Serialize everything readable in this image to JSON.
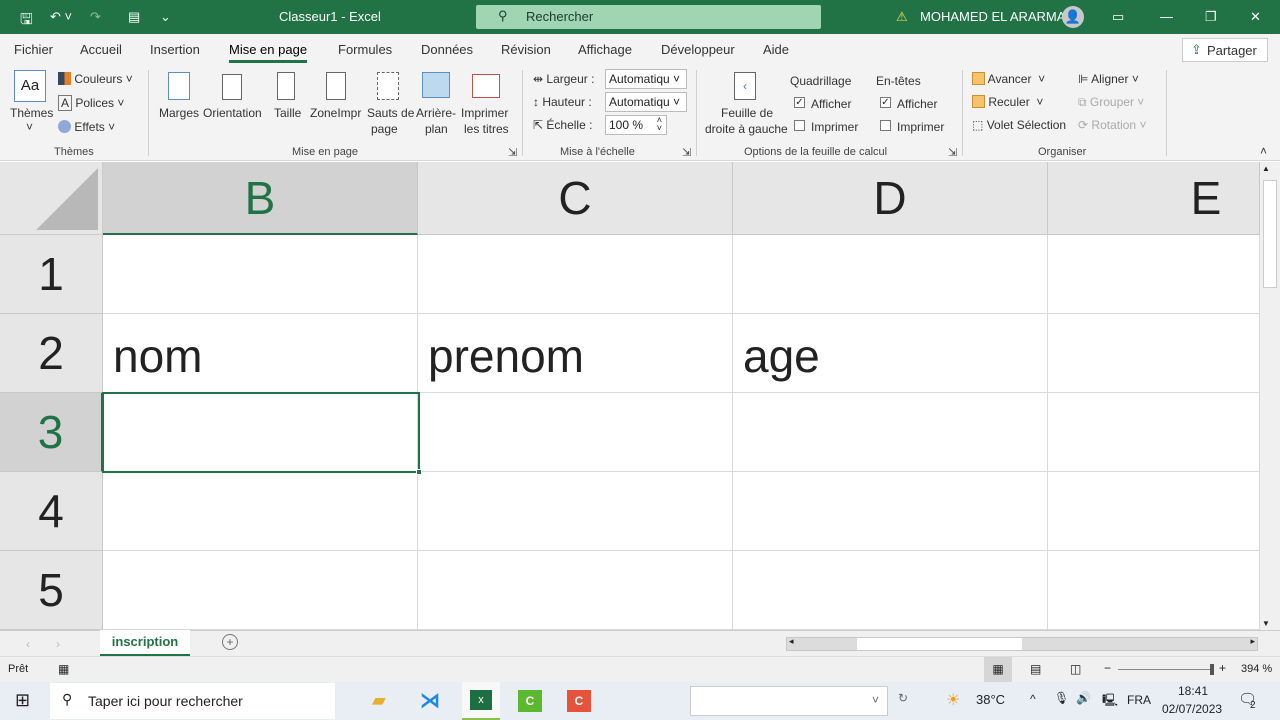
{
  "titlebar": {
    "title": "Classeur1  -  Excel",
    "search_placeholder": "Rechercher",
    "user": "MOHAMED EL ARARMA",
    "accent": "#217346"
  },
  "tabs": [
    {
      "label": "Fichier"
    },
    {
      "label": "Accueil"
    },
    {
      "label": "Insertion"
    },
    {
      "label": "Mise en page",
      "active": true
    },
    {
      "label": "Formules"
    },
    {
      "label": "Données"
    },
    {
      "label": "Révision"
    },
    {
      "label": "Affichage"
    },
    {
      "label": "Développeur"
    },
    {
      "label": "Aide"
    }
  ],
  "share_label": "Partager",
  "ribbon": {
    "themes": {
      "themes": "Thèmes",
      "couleurs": "Couleurs",
      "polices": "Polices",
      "effets": "Effets",
      "group": "Thèmes"
    },
    "page": {
      "marges": "Marges",
      "orientation": "Orientation",
      "taille": "Taille",
      "zone": "ZoneImpr",
      "sauts1": "Sauts de",
      "sauts2": "page",
      "arriere1": "Arrière-",
      "arriere2": "plan",
      "titres1": "Imprimer",
      "titres2": "les titres",
      "group": "Mise en page"
    },
    "scale": {
      "largeur": "Largeur :",
      "largeur_val": "Automatiqu",
      "hauteur": "Hauteur :",
      "hauteur_val": "Automatiqu",
      "echelle": "Échelle :",
      "echelle_val": "100 %",
      "group": "Mise à l'échelle"
    },
    "options": {
      "feuille1": "Feuille de",
      "feuille2": "droite à gauche",
      "quadrillage": "Quadrillage",
      "entetes": "En-têtes",
      "afficher": "Afficher",
      "imprimer": "Imprimer",
      "grid_show": true,
      "grid_print": false,
      "head_show": true,
      "head_print": false,
      "group": "Options de la feuille de calcul"
    },
    "arrange": {
      "avancer": "Avancer",
      "reculer": "Reculer",
      "volet": "Volet Sélection",
      "aligner": "Aligner",
      "grouper": "Grouper",
      "rotation": "Rotation",
      "group": "Organiser"
    }
  },
  "grid": {
    "columns": [
      "B",
      "C",
      "D",
      "E"
    ],
    "selected_column": "B",
    "rows": [
      "1",
      "2",
      "3",
      "4",
      "5"
    ],
    "selected_row": "3",
    "cells": {
      "B2": "nom",
      "C2": "prenom",
      "D2": "age"
    }
  },
  "sheets": [
    {
      "label": "inscription",
      "active": true
    }
  ],
  "status": {
    "ready": "Prêt",
    "zoom": "394 %"
  },
  "taskbar": {
    "search": "Taper ici pour rechercher",
    "temp": "38°C",
    "lang": "FRA",
    "time": "18:41",
    "date": "02/07/2023",
    "notifications": "2"
  }
}
